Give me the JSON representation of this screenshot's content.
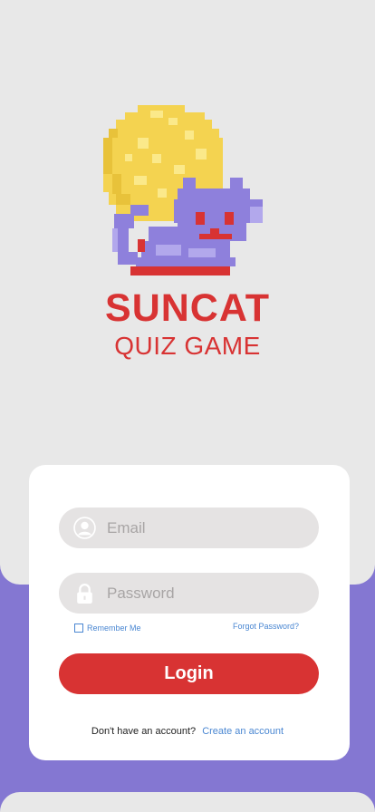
{
  "branding": {
    "title": "SUNCAT",
    "subtitle": "QUIZ GAME",
    "logo_icon": "pixel-sun-cat-logo"
  },
  "login_form": {
    "email": {
      "placeholder": "Email",
      "value": "",
      "icon": "user-avatar-icon"
    },
    "password": {
      "placeholder": "Password",
      "value": "",
      "icon": "padlock-icon"
    },
    "remember_label": "Remember Me",
    "remember_checked": false,
    "forgot_label": "Forgot Password?",
    "login_label": "Login",
    "signup_prompt": "Don't have an account?",
    "signup_link": "Create an account"
  },
  "colors": {
    "brand_red": "#d83333",
    "accent_purple": "#8477d2",
    "link_blue": "#4a87d2",
    "panel_gray": "#e8e8e8"
  }
}
